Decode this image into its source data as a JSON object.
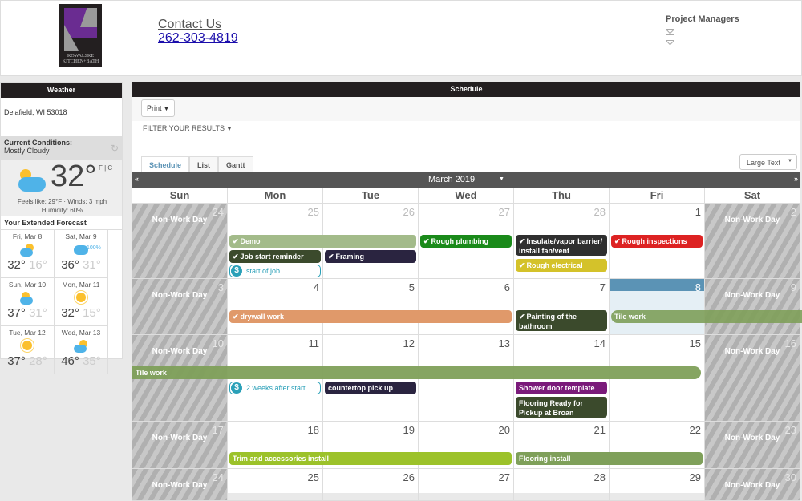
{
  "header": {
    "logo_line1": "KOWALSKE",
    "logo_line2": "KITCHEN+BATH",
    "contact_label": "Contact Us",
    "phone": "262-303-4819",
    "pm_title": "Project Managers"
  },
  "weather": {
    "title": "Weather",
    "location": "Delafield, WI 53018",
    "conditions_label": "Current Conditions:",
    "conditions": "Mostly Cloudy",
    "temp": "32°",
    "unit_f": "F",
    "unit_c": "C",
    "feels": "Feels like: 29°F · Winds: 3 mph",
    "humidity": "Humidity: 60%",
    "extended_title": "Your Extended Forecast",
    "forecast": [
      {
        "day": "Fri, Mar 8",
        "icon": "partly-cloudy",
        "hi": "32°",
        "lo": "16°"
      },
      {
        "day": "Sat, Mar 9",
        "icon": "rain",
        "precip": "100%",
        "hi": "36°",
        "lo": "31°"
      },
      {
        "day": "Sun, Mar 10",
        "icon": "partly-cloudy",
        "hi": "37°",
        "lo": "31°"
      },
      {
        "day": "Mon, Mar 11",
        "icon": "sunny",
        "hi": "32°",
        "lo": "15°"
      },
      {
        "day": "Tue, Mar 12",
        "icon": "sunny",
        "hi": "37°",
        "lo": "28°"
      },
      {
        "day": "Wed, Mar 13",
        "icon": "partly-cloudy-rain",
        "hi": "46°",
        "lo": "35°"
      }
    ]
  },
  "schedule": {
    "title": "Schedule",
    "print_label": "Print",
    "filter_label": "FILTER YOUR RESULTS",
    "tabs": [
      "Schedule",
      "List",
      "Gantt"
    ],
    "active_tab": "Schedule",
    "text_size": "Large Text",
    "month": "March 2019",
    "prev": "«",
    "next": "»",
    "dow": [
      "Sun",
      "Mon",
      "Tue",
      "Wed",
      "Thu",
      "Fri",
      "Sat"
    ],
    "non_work_label": "Non-Work Day",
    "weeks": [
      [
        "24",
        "25",
        "26",
        "27",
        "28",
        "1",
        "2"
      ],
      [
        "3",
        "4",
        "5",
        "6",
        "7",
        "8",
        "9"
      ],
      [
        "10",
        "11",
        "12",
        "13",
        "14",
        "15",
        "16"
      ],
      [
        "17",
        "18",
        "19",
        "20",
        "21",
        "22",
        "23"
      ],
      [
        "24",
        "25",
        "26",
        "27",
        "28",
        "29",
        "30"
      ]
    ],
    "events": {
      "demo": "Demo",
      "job_start": "Job start reminder",
      "framing": "Framing",
      "start_of_job": "start of job",
      "rough_plumbing": "Rough plumbing",
      "insulate": "Insulate/vapor barrier/ install fan/vent",
      "rough_electrical": "Rough electrical",
      "rough_inspections": "Rough inspections",
      "drywall": "drywall work",
      "painting": "Painting of the bathroom",
      "tile1": "Tile work",
      "tile2": "Tile work",
      "two_weeks": "2 weeks after start",
      "countertop": "countertop pick up",
      "shower_door": "Shower door template",
      "flooring_ready": "Flooring Ready for Pickup at Broan",
      "trim": "Trim and accessories install",
      "flooring_install": "Flooring install"
    },
    "colors": {
      "demo": "#a3bb8a",
      "dark_olive": "#3b4a2c",
      "navy": "#2a2440",
      "green": "#1a8a1a",
      "charcoal": "#2f2f2f",
      "yellow": "#d4c22a",
      "red": "#dd2222",
      "orange": "#e0996a",
      "tile": "#7fa05a",
      "purple": "#7a1a7a",
      "lime": "#9cc22a",
      "today": "#5b93b5",
      "payment": "#2aa0b8"
    }
  }
}
